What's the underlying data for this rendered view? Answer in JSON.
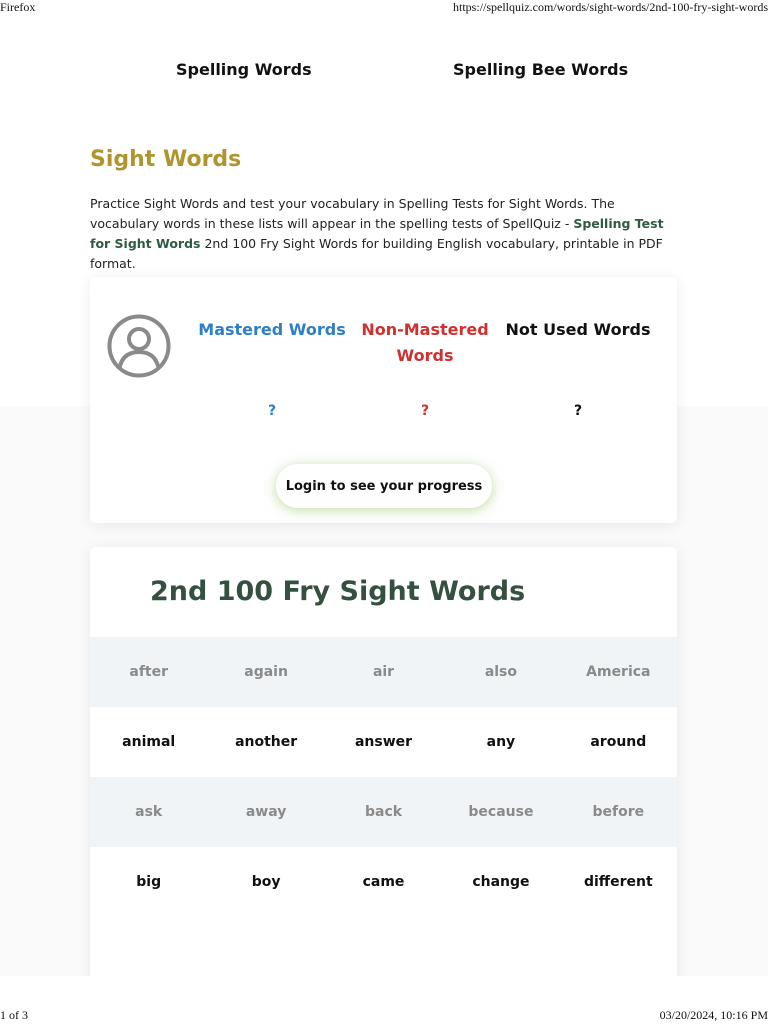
{
  "print": {
    "browser": "Firefox",
    "url": "https://spellquiz.com/words/sight-words/2nd-100-fry-sight-words",
    "page_indicator": "1 of 3",
    "timestamp": "03/20/2024, 10:16 PM"
  },
  "nav": {
    "items": [
      "Spelling Words",
      "Spelling Bee Words"
    ]
  },
  "page": {
    "heading": "Sight Words",
    "intro_before_link": "Practice Sight Words and test your vocabulary in Spelling Tests for Sight Words. The vocabulary words in these lists will appear in the spelling tests of SpellQuiz - ",
    "intro_link": "Spelling Test for Sight Words",
    "intro_after_link": " 2nd 100 Fry Sight Words for building English vocabulary, printable in PDF format."
  },
  "progress": {
    "mastered_label": "Mastered Words",
    "non_mastered_label": "Non-Mastered Words",
    "not_used_label": "Not Used Words",
    "mastered_value": "?",
    "non_mastered_value": "?",
    "not_used_value": "?",
    "login_button": "Login to see your progress",
    "colors": {
      "mastered": "#2e7fc8",
      "non_mastered": "#d03030",
      "not_used": "#111111"
    },
    "avatar_icon": "user-circle-icon"
  },
  "word_list": {
    "title": "2nd 100 Fry Sight Words",
    "rows": [
      [
        "after",
        "again",
        "air",
        "also",
        "America"
      ],
      [
        "animal",
        "another",
        "answer",
        "any",
        "around"
      ],
      [
        "ask",
        "away",
        "back",
        "because",
        "before"
      ],
      [
        "big",
        "boy",
        "came",
        "change",
        "different"
      ]
    ]
  }
}
